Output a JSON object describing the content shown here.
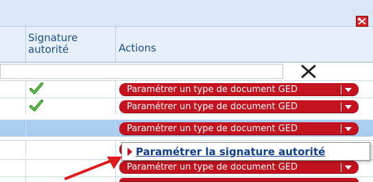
{
  "columns": {
    "signature": "Signature\nautorité",
    "actions": "Actions"
  },
  "filter": {
    "value": "",
    "placeholder": ""
  },
  "rows": [
    {
      "checked": true,
      "action_label": "Paramétrer un type de document GED",
      "selected": false
    },
    {
      "checked": true,
      "action_label": "Paramétrer un type de document GED",
      "selected": false
    },
    {
      "checked": false,
      "action_label": "Paramétrer un type de document GED",
      "selected": true
    },
    {
      "checked": false,
      "action_label": "",
      "selected": false
    },
    {
      "checked": false,
      "action_label": "Paramétrer un type de document GED",
      "selected": false
    }
  ],
  "dropdown_menu": {
    "item": "Paramétrer la signature autorité"
  },
  "colors": {
    "pill": "#c4121f",
    "selected_row": "#a9cdf1",
    "header_text": "#1a4f8f",
    "menu_text": "#0f3f8c",
    "annotation_arrow": "#e01a1a"
  },
  "icons": {
    "export_close": "close-export-icon",
    "clear_filter": "close-x-icon",
    "check": "checkmark-icon",
    "menu_bullet": "triangle-right-icon"
  }
}
